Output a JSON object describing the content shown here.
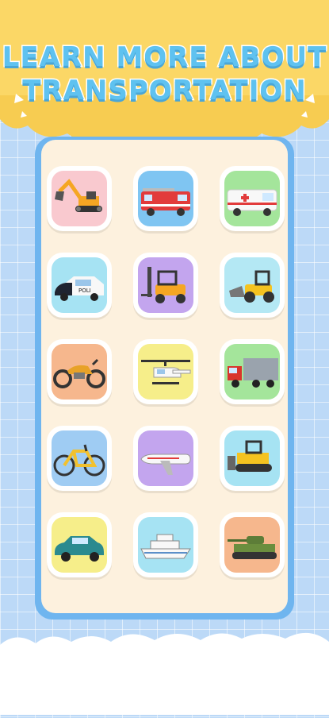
{
  "header": {
    "line1": "LEARN MORE ABOUT",
    "line2": "TRANSPORTATION",
    "banner_color": "#fbd766",
    "title_color": "#5fc2f0"
  },
  "board": {
    "frame_color": "#6fb5ef",
    "panel_color": "#fdf1de"
  },
  "vehicles": [
    {
      "name": "excavator",
      "bg": "#f9c9cf"
    },
    {
      "name": "fire-truck",
      "bg": "#7fc5f2"
    },
    {
      "name": "ambulance",
      "bg": "#a4e59b"
    },
    {
      "name": "police-car",
      "bg": "#a6e3f3",
      "text": "POLI"
    },
    {
      "name": "forklift",
      "bg": "#c3a5ee"
    },
    {
      "name": "bulldozer",
      "bg": "#b4e8f4"
    },
    {
      "name": "motorcycle",
      "bg": "#f6b78d"
    },
    {
      "name": "helicopter",
      "bg": "#f6ee8a"
    },
    {
      "name": "cargo-truck",
      "bg": "#a4e59b"
    },
    {
      "name": "bicycle",
      "bg": "#9fccf3"
    },
    {
      "name": "airplane",
      "bg": "#c3a5ee"
    },
    {
      "name": "crawler-dozer",
      "bg": "#a6e3f3"
    },
    {
      "name": "car",
      "bg": "#f6ee8a"
    },
    {
      "name": "ship",
      "bg": "#a6e3f3"
    },
    {
      "name": "tank",
      "bg": "#f6b78d"
    }
  ]
}
